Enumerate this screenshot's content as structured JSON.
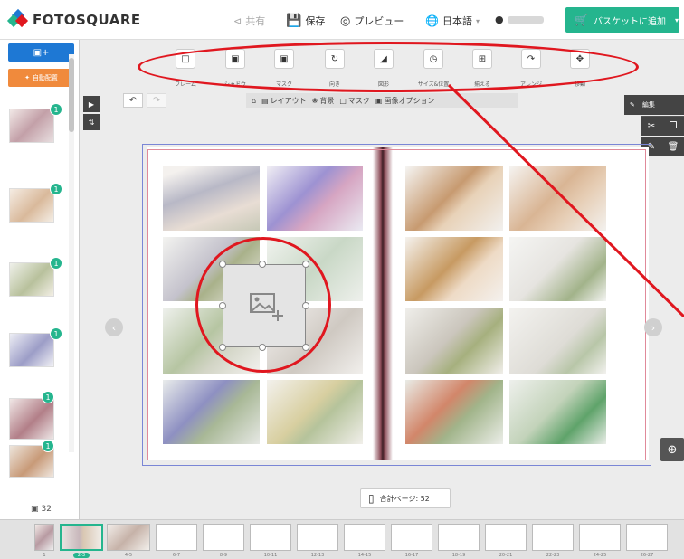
{
  "header": {
    "logo_text": "FOTOSQUARE",
    "share_label": "共有",
    "save_label": "保存",
    "preview_label": "プレビュー",
    "language_label": "日本語",
    "basket_label": "バスケットに追加"
  },
  "sidebar": {
    "add_photo_label": "+",
    "auto_layout_label": "自動配置",
    "thumb_badges": [
      "1",
      "1",
      "1",
      "1",
      "1",
      "1"
    ],
    "photo_count": "32"
  },
  "toolbar": {
    "items": [
      {
        "label": "フレーム",
        "icon": "frame-icon"
      },
      {
        "label": "シャドウ",
        "icon": "shadow-icon"
      },
      {
        "label": "マスク",
        "icon": "mask-icon"
      },
      {
        "label": "向き",
        "icon": "rotate-icon"
      },
      {
        "label": "図形",
        "icon": "shape-icon"
      },
      {
        "label": "サイズ&位置",
        "icon": "size-position-icon"
      },
      {
        "label": "揃える",
        "icon": "align-icon"
      },
      {
        "label": "アレンジ",
        "icon": "arrange-icon"
      },
      {
        "label": "移動",
        "icon": "move-icon"
      }
    ]
  },
  "subtoolbar": {
    "layout_label": "レイアウト",
    "background_label": "背景",
    "mask_label": "マスク",
    "image_option_label": "画像オプション"
  },
  "right_panel": {
    "edit_label": "編集"
  },
  "footer": {
    "total_pages_label": "合計ページ: 52"
  },
  "bottom_strip": {
    "pages": [
      "1",
      "2-3",
      "4-5",
      "6-7",
      "8-9",
      "10-11",
      "12-13",
      "14-15",
      "16-17",
      "18-19",
      "20-21",
      "22-23",
      "24-25",
      "26-27"
    ]
  },
  "colors": {
    "accent_blue": "#1e78d4",
    "accent_orange": "#f08a3c",
    "basket_green": "#25b58e",
    "annotation_red": "#e0171f"
  }
}
